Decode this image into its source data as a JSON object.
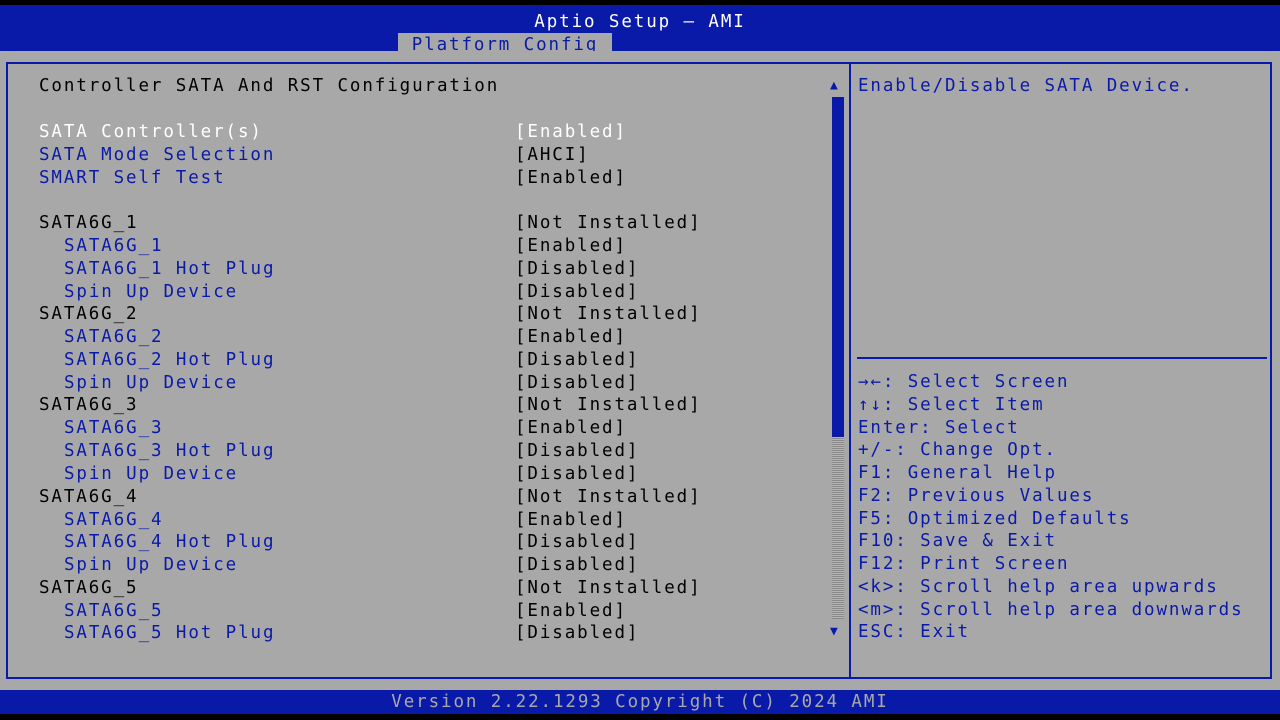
{
  "header": {
    "title": "Aptio Setup – AMI",
    "tab": "Platform Config"
  },
  "page": {
    "heading": "Controller SATA And RST Configuration"
  },
  "settings": [
    {
      "label": "SATA Controller(s)",
      "value": "[Enabled]",
      "indent": 0,
      "kind": "selected"
    },
    {
      "label": "SATA Mode Selection",
      "value": "[AHCI]",
      "indent": 0,
      "kind": "option"
    },
    {
      "label": "SMART Self Test",
      "value": "[Enabled]",
      "indent": 0,
      "kind": "option"
    },
    {
      "label": "SATA6G_1",
      "value": "[Not Installed]",
      "indent": 0,
      "kind": "static"
    },
    {
      "label": "SATA6G_1",
      "value": "[Enabled]",
      "indent": 1,
      "kind": "option"
    },
    {
      "label": "SATA6G_1 Hot Plug",
      "value": "[Disabled]",
      "indent": 1,
      "kind": "option"
    },
    {
      "label": "Spin Up Device",
      "value": "[Disabled]",
      "indent": 1,
      "kind": "option"
    },
    {
      "label": "SATA6G_2",
      "value": "[Not Installed]",
      "indent": 0,
      "kind": "static"
    },
    {
      "label": "SATA6G_2",
      "value": "[Enabled]",
      "indent": 1,
      "kind": "option"
    },
    {
      "label": "SATA6G_2 Hot Plug",
      "value": "[Disabled]",
      "indent": 1,
      "kind": "option"
    },
    {
      "label": "Spin Up Device",
      "value": "[Disabled]",
      "indent": 1,
      "kind": "option"
    },
    {
      "label": "SATA6G_3",
      "value": "[Not Installed]",
      "indent": 0,
      "kind": "static"
    },
    {
      "label": "SATA6G_3",
      "value": "[Enabled]",
      "indent": 1,
      "kind": "option"
    },
    {
      "label": "SATA6G_3 Hot Plug",
      "value": "[Disabled]",
      "indent": 1,
      "kind": "option"
    },
    {
      "label": "Spin Up Device",
      "value": "[Disabled]",
      "indent": 1,
      "kind": "option"
    },
    {
      "label": "SATA6G_4",
      "value": "[Not Installed]",
      "indent": 0,
      "kind": "static"
    },
    {
      "label": "SATA6G_4",
      "value": "[Enabled]",
      "indent": 1,
      "kind": "option"
    },
    {
      "label": "SATA6G_4 Hot Plug",
      "value": "[Disabled]",
      "indent": 1,
      "kind": "option"
    },
    {
      "label": "Spin Up Device",
      "value": "[Disabled]",
      "indent": 1,
      "kind": "option"
    },
    {
      "label": "SATA6G_5",
      "value": "[Not Installed]",
      "indent": 0,
      "kind": "static"
    },
    {
      "label": "SATA6G_5",
      "value": "[Enabled]",
      "indent": 1,
      "kind": "option"
    },
    {
      "label": "SATA6G_5 Hot Plug",
      "value": "[Disabled]",
      "indent": 1,
      "kind": "option"
    }
  ],
  "help": {
    "description": "Enable/Disable SATA Device.",
    "keys": [
      "→←: Select Screen",
      "↑↓: Select Item",
      "Enter: Select",
      "+/-: Change Opt.",
      "F1: General Help",
      "F2: Previous Values",
      "F5: Optimized Defaults",
      "F10: Save & Exit",
      "F12: Print Screen",
      "<k>: Scroll help area upwards",
      "<m>: Scroll help area downwards",
      "ESC: Exit"
    ]
  },
  "scrollbar": {
    "up_icon": "▲",
    "down_icon": "▼",
    "visible_fraction": 0.65
  },
  "footer": {
    "text": "Version 2.22.1293 Copyright (C) 2024 AMI"
  },
  "colors": {
    "background": "#a8a8a8",
    "accent": "#0a1aa8",
    "selected_text": "#ffffff"
  }
}
